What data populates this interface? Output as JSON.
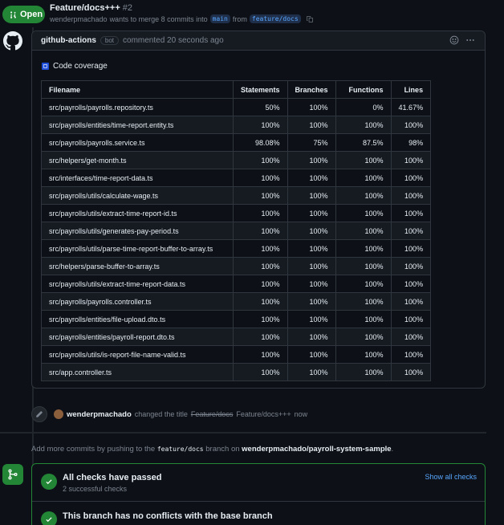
{
  "header": {
    "status_label": "Open",
    "title": "Feature/docs+++",
    "number": "#2",
    "author": "wenderpmachado",
    "merge_text_1": "wants to merge 8 commits into",
    "base_branch": "main",
    "merge_text_2": "from",
    "head_branch": "feature/docs"
  },
  "comment": {
    "author": "github-actions",
    "badge": "bot",
    "time_text": "commented 20 seconds ago",
    "coverage_title": "Code coverage",
    "columns": [
      "Filename",
      "Statements",
      "Branches",
      "Functions",
      "Lines"
    ],
    "rows": [
      [
        "src/payrolls/payrolls.repository.ts",
        "50%",
        "100%",
        "0%",
        "41.67%"
      ],
      [
        "src/payrolls/entities/time-report.entity.ts",
        "100%",
        "100%",
        "100%",
        "100%"
      ],
      [
        "src/payrolls/payrolls.service.ts",
        "98.08%",
        "75%",
        "87.5%",
        "98%"
      ],
      [
        "src/helpers/get-month.ts",
        "100%",
        "100%",
        "100%",
        "100%"
      ],
      [
        "src/interfaces/time-report-data.ts",
        "100%",
        "100%",
        "100%",
        "100%"
      ],
      [
        "src/payrolls/utils/calculate-wage.ts",
        "100%",
        "100%",
        "100%",
        "100%"
      ],
      [
        "src/payrolls/utils/extract-time-report-id.ts",
        "100%",
        "100%",
        "100%",
        "100%"
      ],
      [
        "src/payrolls/utils/generates-pay-period.ts",
        "100%",
        "100%",
        "100%",
        "100%"
      ],
      [
        "src/payrolls/utils/parse-time-report-buffer-to-array.ts",
        "100%",
        "100%",
        "100%",
        "100%"
      ],
      [
        "src/helpers/parse-buffer-to-array.ts",
        "100%",
        "100%",
        "100%",
        "100%"
      ],
      [
        "src/payrolls/utils/extract-time-report-data.ts",
        "100%",
        "100%",
        "100%",
        "100%"
      ],
      [
        "src/payrolls/payrolls.controller.ts",
        "100%",
        "100%",
        "100%",
        "100%"
      ],
      [
        "src/payrolls/entities/file-upload.dto.ts",
        "100%",
        "100%",
        "100%",
        "100%"
      ],
      [
        "src/payrolls/entities/payroll-report.dto.ts",
        "100%",
        "100%",
        "100%",
        "100%"
      ],
      [
        "src/payrolls/utils/is-report-file-name-valid.ts",
        "100%",
        "100%",
        "100%",
        "100%"
      ],
      [
        "src/app.controller.ts",
        "100%",
        "100%",
        "100%",
        "100%"
      ]
    ]
  },
  "event": {
    "author": "wenderpmachado",
    "text_1": "changed the title",
    "old_title": "Feature/docs",
    "new_title": "Feature/docs+++",
    "time": "now"
  },
  "add_more": {
    "text_1": "Add more commits by pushing to the",
    "branch": "feature/docs",
    "text_2": "branch on",
    "repo": "wenderpmachado/payroll-system-sample",
    "text_3": "."
  },
  "checks": {
    "title": "All checks have passed",
    "subtitle": "2 successful checks",
    "show_all": "Show all checks",
    "conflicts_title": "This branch has no conflicts with the base branch"
  },
  "colors": {
    "open_green": "#238636",
    "link_blue": "#58a6ff",
    "background": "#0d1117"
  }
}
